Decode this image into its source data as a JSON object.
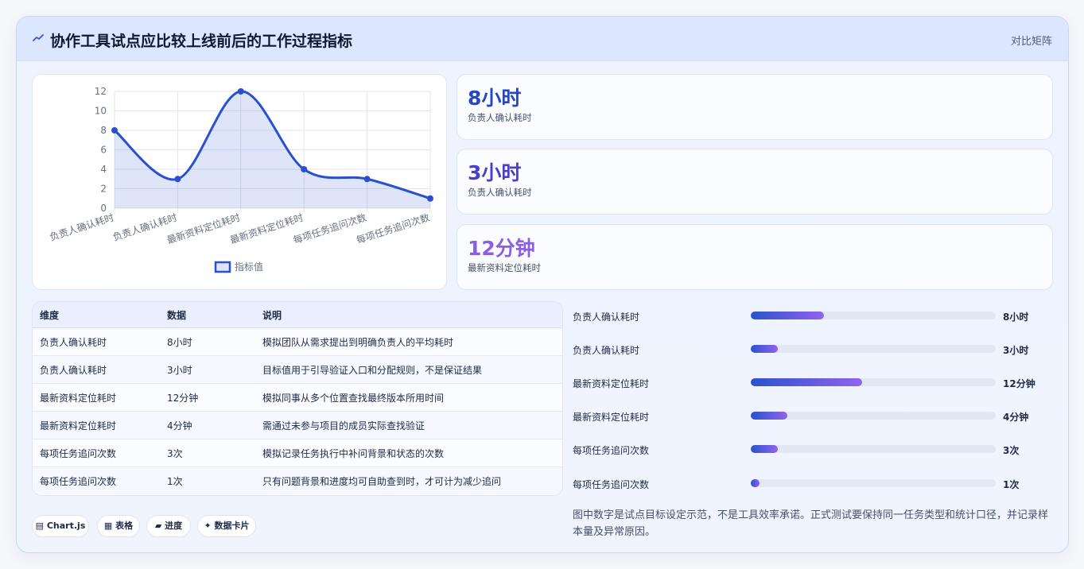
{
  "header": {
    "icon": "trend-line-icon",
    "title": "协作工具试点应比较上线前后的工作过程指标",
    "tag": "对比矩阵"
  },
  "chart_data": {
    "type": "line",
    "categories": [
      "负责人确认耗时",
      "负责人确认耗时",
      "最新资料定位耗时",
      "最新资料定位耗时",
      "每项任务追问次数",
      "每项任务追问次数"
    ],
    "series": [
      {
        "name": "指标值",
        "values": [
          8,
          3,
          12,
          4,
          3,
          1
        ],
        "color": "#2a4fcf"
      }
    ],
    "yticks": [
      0,
      2,
      4,
      6,
      8,
      10,
      12
    ],
    "ylim": [
      0,
      12
    ],
    "fill": "area",
    "grid": true,
    "legend": "bottom"
  },
  "stats": [
    {
      "value": "8小时",
      "label": "负责人确认耗时",
      "color": "#2547c4"
    },
    {
      "value": "3小时",
      "label": "负责人确认耗时",
      "color": "#4a3fc8"
    },
    {
      "value": "12分钟",
      "label": "最新资料定位耗时",
      "color": "#8a5fe6"
    }
  ],
  "table": {
    "headers": [
      "维度",
      "数据",
      "说明"
    ],
    "rows": [
      [
        "负责人确认耗时",
        "8小时",
        "模拟团队从需求提出到明确负责人的平均耗时"
      ],
      [
        "负责人确认耗时",
        "3小时",
        "目标值用于引导验证入口和分配规则，不是保证结果"
      ],
      [
        "最新资料定位耗时",
        "12分钟",
        "模拟同事从多个位置查找最终版本所用时间"
      ],
      [
        "最新资料定位耗时",
        "4分钟",
        "需通过未参与项目的成员实际查找验证"
      ],
      [
        "每项任务追问次数",
        "3次",
        "模拟记录任务执行中补问背景和状态的次数"
      ],
      [
        "每项任务追问次数",
        "1次",
        "只有问题背景和进度均可自助查到时，才可计为减少追问"
      ]
    ]
  },
  "bars": [
    {
      "label": "负责人确认耗时",
      "value": "8小时",
      "fraction": 0.3
    },
    {
      "label": "负责人确认耗时",
      "value": "3小时",
      "fraction": 0.11
    },
    {
      "label": "最新资料定位耗时",
      "value": "12分钟",
      "fraction": 0.455
    },
    {
      "label": "最新资料定位耗时",
      "value": "4分钟",
      "fraction": 0.15
    },
    {
      "label": "每项任务追问次数",
      "value": "3次",
      "fraction": 0.11
    },
    {
      "label": "每项任务追问次数",
      "value": "1次",
      "fraction": 0.035
    }
  ],
  "chips": [
    {
      "icon": "chart-icon",
      "glyph": "▤",
      "label": "Chart.js"
    },
    {
      "icon": "table-icon",
      "glyph": "▦",
      "label": "表格"
    },
    {
      "icon": "progress-icon",
      "glyph": "▰",
      "label": "进度"
    },
    {
      "icon": "sparkle-icon",
      "glyph": "✦",
      "label": "数据卡片"
    }
  ],
  "note": "图中数字是试点目标设定示范，不是工具效率承诺。正式测试要保持同一任务类型和统计口径，并记录样本量及异常原因。"
}
